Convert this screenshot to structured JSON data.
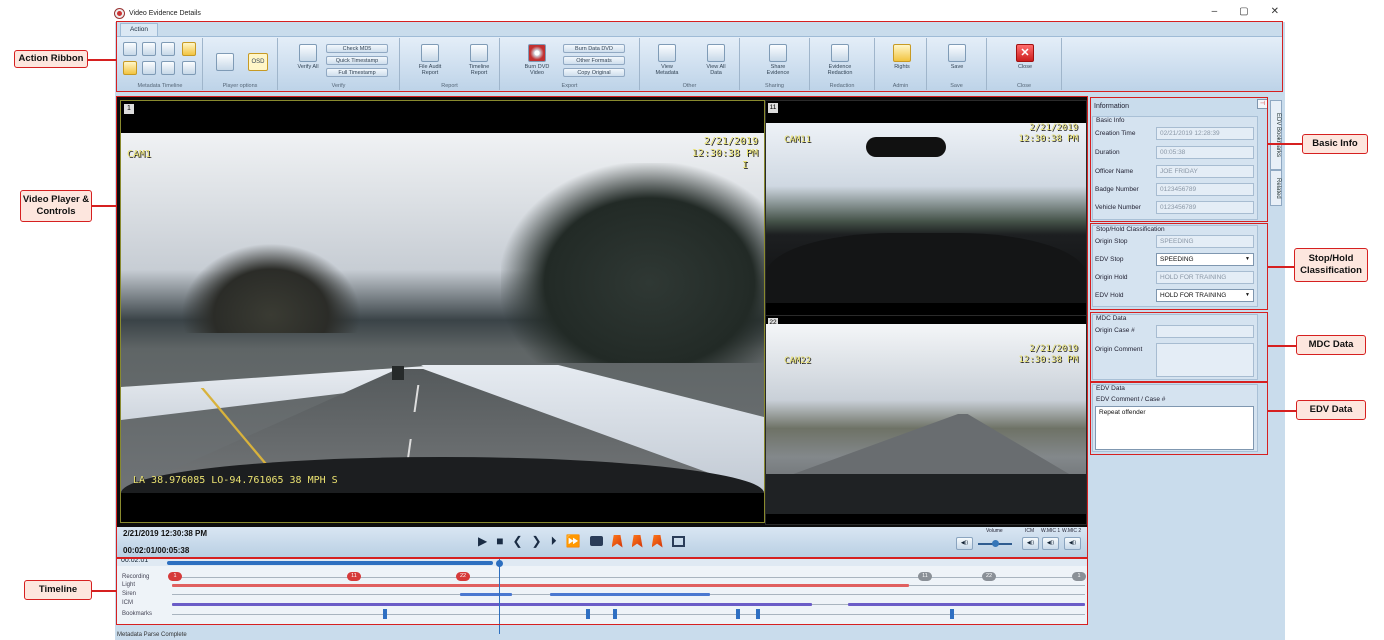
{
  "window": {
    "title": "Video Evidence Details",
    "controls": [
      "–",
      "▢",
      "✕"
    ]
  },
  "ribbon": {
    "tab": "Action",
    "groups": {
      "metadata_timeline": "Metadata Timeline",
      "player_options": "Player options",
      "verify": "Verify",
      "report": "Report",
      "export": "Export",
      "other": "Other",
      "sharing": "Sharing",
      "redaction": "Redaction",
      "admin": "Admin",
      "save": "Save",
      "close": "Close"
    },
    "buttons": {
      "osd": "OSD",
      "verify_all": "Verify All",
      "check_md5": "Check MD5",
      "quick_timestamp": "Quick Timestamp",
      "full_timestamp": "Full Timestamp",
      "file_audit_report": "File Audit Report",
      "timeline_report": "Timeline Report",
      "burn_dvd_video": "Burn DVD Video",
      "burn_data_dvd": "Burn Data DVD",
      "other_formats": "Other Formats",
      "copy_original": "Copy Original",
      "view_metadata": "View Metadata",
      "view_all_data": "View All Data",
      "share_evidence": "Share Evidence",
      "evidence_redaction": "Evidence Redaction",
      "rights": "Rights",
      "save": "Save",
      "close": "Close"
    }
  },
  "video": {
    "main": {
      "number": "1",
      "cam": "CAM1",
      "date": "2/21/2019",
      "time": "12:30:38 PM",
      "flag": "I",
      "gps": "LA 38.976085 LO-94.761065 38 MPH S"
    },
    "cam11": {
      "number": "11",
      "cam": "CAM11",
      "date": "2/21/2019",
      "time": "12:30:38 PM"
    },
    "cam22": {
      "number": "22",
      "cam": "CAM22",
      "date": "2/21/2019",
      "time": "12:30:38 PM"
    }
  },
  "player": {
    "timestamp": "2/21/2019 12:30:38 PM",
    "position": "00:02:01/00:05:38",
    "audio": {
      "volume_label": "Volume",
      "icm_label": "ICM",
      "wmic1_label": "W.MIC 1",
      "wmic2_label": "W.MIC 2",
      "mute_glyph": "◀))"
    }
  },
  "timeline": {
    "current": "00:02:01",
    "rows": [
      "Recording",
      "Light",
      "Siren",
      "ICM",
      "Bookmarks"
    ],
    "badges": [
      "1",
      "11",
      "22",
      "11",
      "22",
      "1"
    ],
    "progress": 0.357
  },
  "status": "Metadata Parse Complete",
  "panel": {
    "header": "Information",
    "pin_glyph": "⊣",
    "tabs": [
      "EDV Bookmarks",
      "Related"
    ],
    "basic_info": {
      "title": "Basic Info",
      "creation_time_label": "Creation Time",
      "creation_time": "02/21/2019 12:28:39",
      "duration_label": "Duration",
      "duration": "00:05:38",
      "officer_name_label": "Officer Name",
      "officer_name": "JOE FRIDAY",
      "badge_number_label": "Badge Number",
      "badge_number": "0123456789",
      "vehicle_number_label": "Vehicle Number",
      "vehicle_number": "0123456789"
    },
    "stop_hold": {
      "title": "Stop/Hold Classification",
      "origin_stop_label": "Origin Stop",
      "origin_stop": "SPEEDING",
      "edv_stop_label": "EDV Stop",
      "edv_stop": "SPEEDING",
      "origin_hold_label": "Origin Hold",
      "origin_hold": "HOLD FOR TRAINING",
      "edv_hold_label": "EDV Hold",
      "edv_hold": "HOLD FOR TRAINING"
    },
    "mdc": {
      "title": "MDC Data",
      "origin_case_label": "Origin Case #",
      "origin_case": "",
      "origin_comment_label": "Origin Comment",
      "origin_comment": ""
    },
    "edv": {
      "title": "EDV Data",
      "comment_label": "EDV Comment / Case #",
      "comment": "Repeat offender"
    }
  },
  "callouts": {
    "action_ribbon": "Action Ribbon",
    "video_player": "Video Player & Controls",
    "timeline": "Timeline",
    "basic_info": "Basic Info",
    "stop_hold": "Stop/Hold Classification",
    "mdc_data": "MDC Data",
    "edv_data": "EDV Data"
  },
  "colors": {
    "annotation": "#d62020",
    "callout_fill": "#fde6de",
    "recording_badge": "#d63a3a",
    "recording_badge_alt": "#8a9097",
    "light_bar": "#e06060",
    "siren_bar": "#4a78d0",
    "icm_bar": "#6a5cc7",
    "bookmark": "#2f6fc2"
  }
}
